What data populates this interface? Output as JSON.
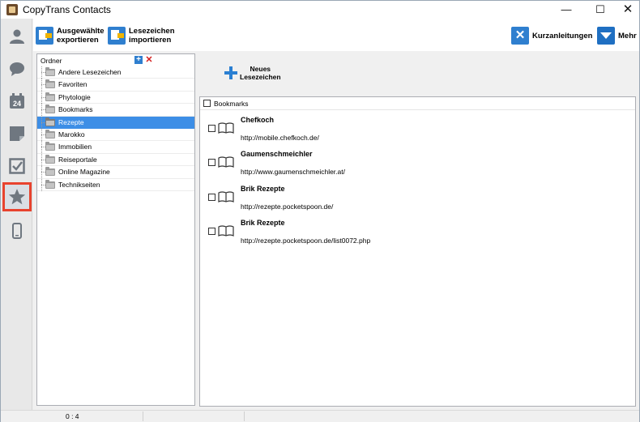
{
  "window": {
    "title": "CopyTrans Contacts"
  },
  "window_controls": {
    "minimize": "—",
    "maximize": "☐",
    "close": "✕"
  },
  "nav": {
    "items": [
      {
        "name": "contacts",
        "icon": "person-icon",
        "glyph": "👤"
      },
      {
        "name": "messages",
        "icon": "chat-bubble-icon",
        "glyph": "💬"
      },
      {
        "name": "calendar",
        "icon": "calendar-icon",
        "glyph": "24"
      },
      {
        "name": "notes",
        "icon": "note-icon",
        "glyph": "▰"
      },
      {
        "name": "tasks",
        "icon": "checkbox-icon",
        "glyph": "☑"
      },
      {
        "name": "bookmarks",
        "icon": "star-icon",
        "glyph": "★",
        "active": true
      },
      {
        "name": "device",
        "icon": "phone-icon",
        "glyph": "▯"
      }
    ]
  },
  "toolbar": {
    "export_label_1": "Ausgewählte",
    "export_label_2": "exportieren",
    "import_label_1": "Lesezeichen",
    "import_label_2": "importieren",
    "tutorials_label": "Kurzanleitungen",
    "more_label": "Mehr"
  },
  "folders": {
    "header": "Ordner",
    "add_glyph": "+",
    "delete_glyph": "✕",
    "items": [
      {
        "label": "Andere Lesezeichen"
      },
      {
        "label": "Favoriten"
      },
      {
        "label": "Phytologie"
      },
      {
        "label": "Bookmarks"
      },
      {
        "label": "Rezepte",
        "selected": true
      },
      {
        "label": "Marokko"
      },
      {
        "label": "Immobilien"
      },
      {
        "label": "Reiseportale"
      },
      {
        "label": "Online Magazine"
      },
      {
        "label": "Technikseiten"
      }
    ]
  },
  "new_bookmark": {
    "label_1": "Neues",
    "label_2": "Lesezeichen"
  },
  "bookmarks": {
    "header": "Bookmarks",
    "items": [
      {
        "title": "Chefkoch",
        "url": "http://mobile.chefkoch.de/"
      },
      {
        "title": "Gaumenschmeichler",
        "url": "http://www.gaumenschmeichler.at/"
      },
      {
        "title": "Brik Rezepte",
        "url": "http://rezepte.pocketspoon.de/"
      },
      {
        "title": "Brik Rezepte",
        "url": "http://rezepte.pocketspoon.de/list0072.php"
      }
    ]
  },
  "status": {
    "count": "0 : 4"
  },
  "colors": {
    "accent": "#2f7fcf",
    "selection": "#3d8ee6",
    "active_nav_border": "#e8432e"
  }
}
